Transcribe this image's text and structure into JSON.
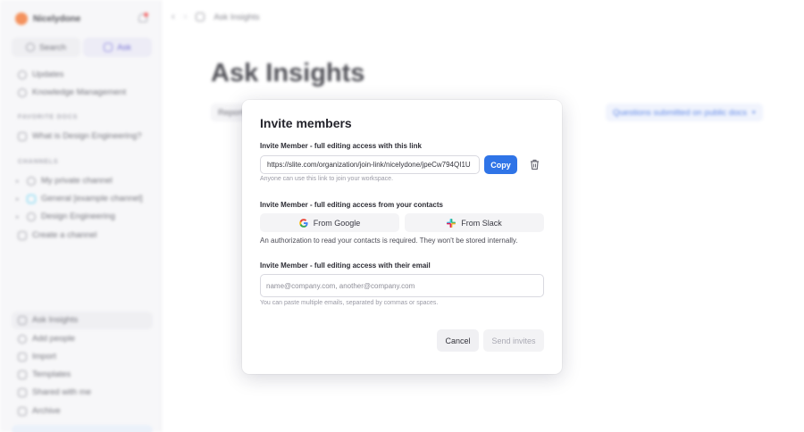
{
  "sidebar": {
    "workspace_name": "Nicelydone",
    "search_label": "Search",
    "ask_label": "Ask",
    "top_items": [
      {
        "label": "Updates",
        "icon": "clock-icon"
      },
      {
        "label": "Knowledge Management",
        "icon": "clock-icon"
      }
    ],
    "favorite_docs_heading": "FAVORITE DOCS",
    "favorite_docs": [
      {
        "label": "What is Design Engineering?",
        "icon": "doc-icon"
      }
    ],
    "channels_heading": "CHANNELS",
    "channels": [
      {
        "label": "My private channel",
        "icon": "lock-icon"
      },
      {
        "label": "General [example channel]",
        "icon": "slack-icon"
      },
      {
        "label": "Design Engineering",
        "icon": "lock-icon"
      }
    ],
    "create_channel_label": "Create a channel",
    "bottom_items": [
      {
        "label": "Ask Insights",
        "icon": "sparkle-icon"
      },
      {
        "label": "Add people",
        "icon": "person-icon"
      },
      {
        "label": "Import",
        "icon": "import-icon"
      },
      {
        "label": "Templates",
        "icon": "template-icon"
      },
      {
        "label": "Shared with me",
        "icon": "share-icon"
      },
      {
        "label": "Archive",
        "icon": "archive-icon"
      }
    ]
  },
  "topnav": {
    "breadcrumb": "Ask Insights"
  },
  "main": {
    "title": "Ask Insights",
    "reports_tab": "Reports",
    "filter_label": "Questions submitted on public docs"
  },
  "modal": {
    "title": "Invite members",
    "link_section_label": "Invite Member - full editing access with this link",
    "invite_link": "https://slite.com/organization/join-link/nicelydone/jpeCw794QI1U",
    "copy_label": "Copy",
    "link_hint": "Anyone can use this link to join your workspace.",
    "contacts_section_label": "Invite Member - full editing access from your contacts",
    "google_label": "From Google",
    "slack_label": "From Slack",
    "contacts_note": "An authorization to read your contacts is required. They won't be stored internally.",
    "email_section_label": "Invite Member - full editing access with their email",
    "email_placeholder": "name@company.com, another@company.com",
    "email_value": "",
    "email_hint": "You can paste multiple emails, separated by commas or spaces.",
    "cancel_label": "Cancel",
    "send_label": "Send invites"
  },
  "colors": {
    "primary": "#2f74e7",
    "brand_logo": "#f27a3a",
    "ask_accent": "#5b55c9"
  }
}
